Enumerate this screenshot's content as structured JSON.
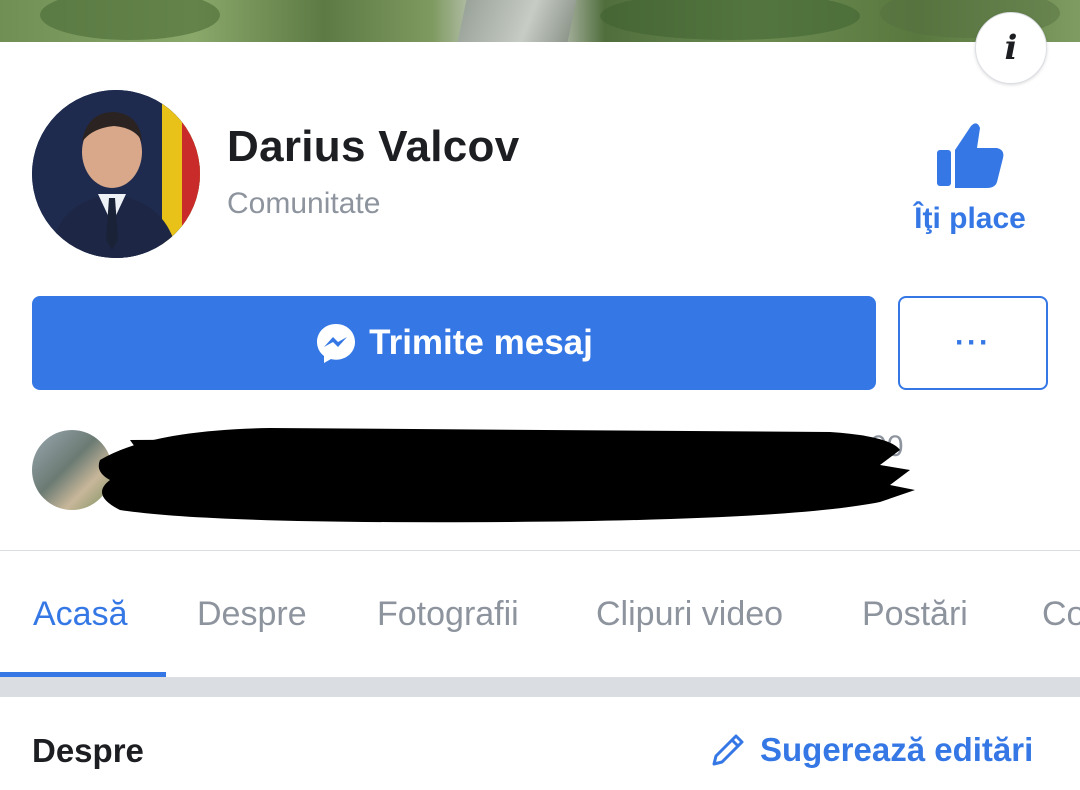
{
  "header": {
    "page_name": "Darius Valcov",
    "category": "Comunitate"
  },
  "actions": {
    "like_label": "Îţi place",
    "message_label": "Trimite mesaj",
    "more_label": "···"
  },
  "friends_row": {
    "visible_text": "... 000"
  },
  "tabs": [
    {
      "label": "Acasă",
      "active": true
    },
    {
      "label": "Despre",
      "active": false
    },
    {
      "label": "Fotografii",
      "active": false
    },
    {
      "label": "Clipuri video",
      "active": false
    },
    {
      "label": "Postări",
      "active": false
    },
    {
      "label": "Co",
      "active": false
    }
  ],
  "about": {
    "title": "Despre",
    "suggest_label": "Sugerează editări"
  },
  "icons": {
    "info": "info-icon",
    "like": "thumbs-up-icon",
    "messenger": "messenger-icon",
    "pencil": "pencil-icon"
  },
  "colors": {
    "accent": "#3578e5",
    "text": "#1c1e21",
    "muted": "#8d949e"
  }
}
